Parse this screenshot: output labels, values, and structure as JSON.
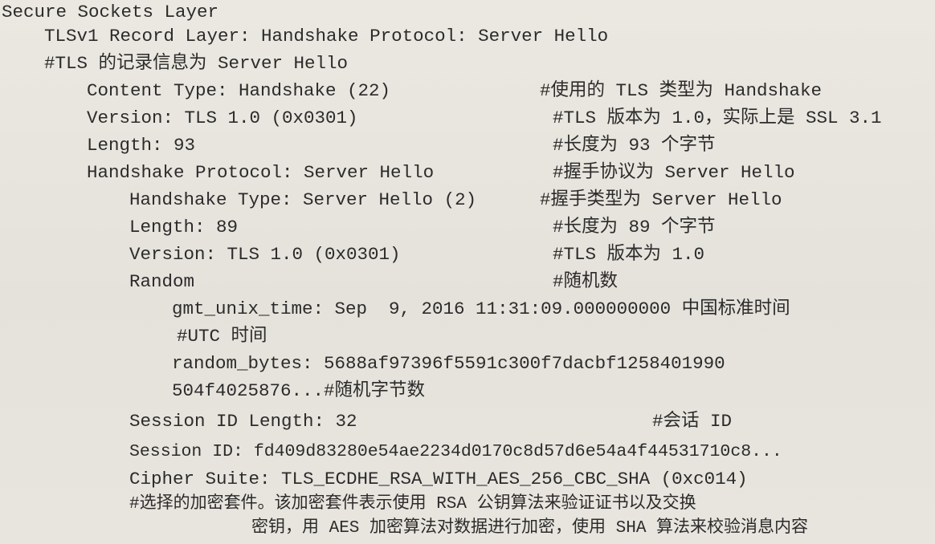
{
  "lines": [
    {
      "text": "Secure Sockets Layer"
    },
    {
      "text": "TLSv1 Record Layer: Handshake Protocol: Server Hello"
    },
    {
      "text": "#TLS 的记录信息为 Server Hello"
    },
    {
      "text": "Content Type: Handshake (22)",
      "comment": "#使用的 TLS 类型为 Handshake"
    },
    {
      "text": "Version: TLS 1.0 (0x0301)",
      "comment": "#TLS 版本为 1.0，实际上是 SSL 3.1"
    },
    {
      "text": "Length: 93",
      "comment": "#长度为 93 个字节"
    },
    {
      "text": "Handshake Protocol: Server Hello",
      "comment": "#握手协议为 Server Hello"
    },
    {
      "text": "Handshake Type: Server Hello (2)",
      "comment": "#握手类型为 Server Hello"
    },
    {
      "text": "Length: 89",
      "comment": "#长度为 89 个字节"
    },
    {
      "text": "Version: TLS 1.0 (0x0301)",
      "comment": "#TLS 版本为 1.0"
    },
    {
      "text": "Random",
      "comment": "#随机数"
    },
    {
      "text": "gmt_unix_time: Sep  9, 2016 11:31:09.000000000 中国标准时间"
    },
    {
      "text": "#UTC 时间"
    },
    {
      "text": "random_bytes: 5688af97396f5591c300f7dacbf1258401990"
    },
    {
      "text": "504f4025876...#随机字节数"
    },
    {
      "text": "Session ID Length: 32",
      "comment": "#会话 ID"
    },
    {
      "text": "Session ID: fd409d83280e54ae2234d0170c8d57d6e54a4f44531710c8..."
    },
    {
      "text": "Cipher Suite: TLS_ECDHE_RSA_WITH_AES_256_CBC_SHA (0xc014)"
    },
    {
      "text": "#选择的加密套件。该加密套件表示使用 RSA 公钥算法来验证证书以及交换"
    },
    {
      "text": "密钥，用 AES 加密算法对数据进行加密，使用 SHA 算法来校验消息内容"
    }
  ]
}
